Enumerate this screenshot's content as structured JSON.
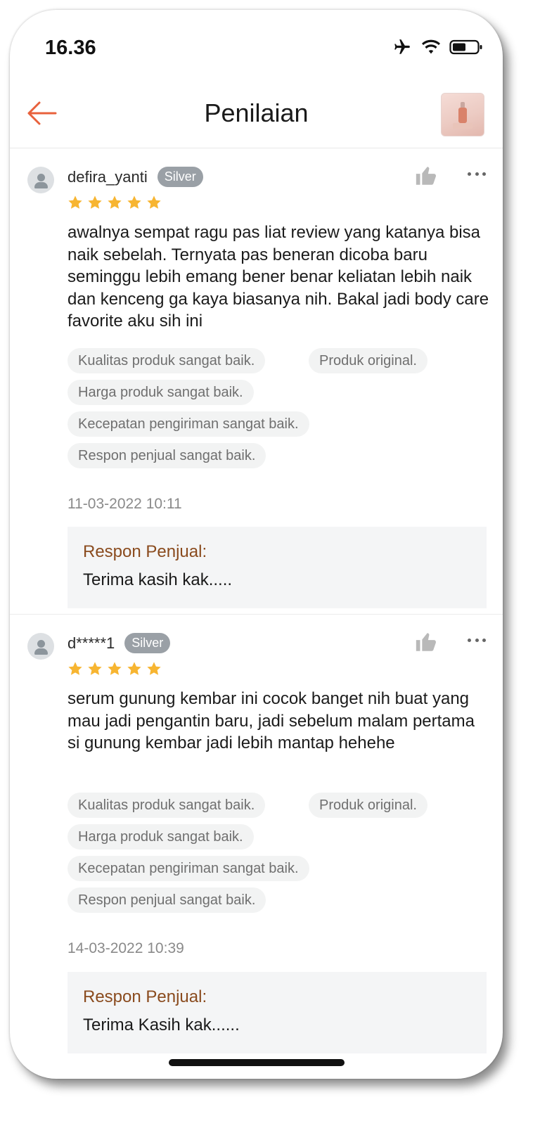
{
  "status_bar": {
    "time": "16.36"
  },
  "header": {
    "title": "Penilaian"
  },
  "reviews": [
    {
      "username": "defira_yanti",
      "badge": "Silver",
      "rating": 5,
      "comment": "awalnya sempat ragu pas liat review yang katanya bisa naik sebelah. Ternyata pas beneran dicoba baru seminggu lebih emang bener benar keliatan lebih naik dan kenceng ga kaya biasanya nih. Bakal jadi body care favorite aku sih ini",
      "tags": [
        "Kualitas produk sangat baik.",
        "Produk original.",
        "Harga produk sangat baik.",
        "Kecepatan pengiriman sangat baik.",
        "Respon penjual sangat baik."
      ],
      "date": "11-03-2022 10:11",
      "seller_response_label": "Respon Penjual:",
      "seller_response": "Terima kasih kak....."
    },
    {
      "username": "d*****1",
      "badge": "Silver",
      "rating": 5,
      "comment": "serum gunung kembar ini cocok banget nih buat yang mau jadi pengantin baru, jadi sebelum malam pertama si gunung kembar jadi lebih mantap hehehe",
      "tags": [
        "Kualitas produk sangat baik.",
        "Produk original.",
        "Harga produk sangat baik.",
        "Kecepatan pengiriman sangat baik.",
        "Respon penjual sangat baik."
      ],
      "date": "14-03-2022 10:39",
      "seller_response_label": "Respon Penjual:",
      "seller_response": "Terima Kasih kak......"
    }
  ],
  "colors": {
    "accent": "#e8613c",
    "star": "#f7b531",
    "seller_label": "#8a4b1e"
  }
}
